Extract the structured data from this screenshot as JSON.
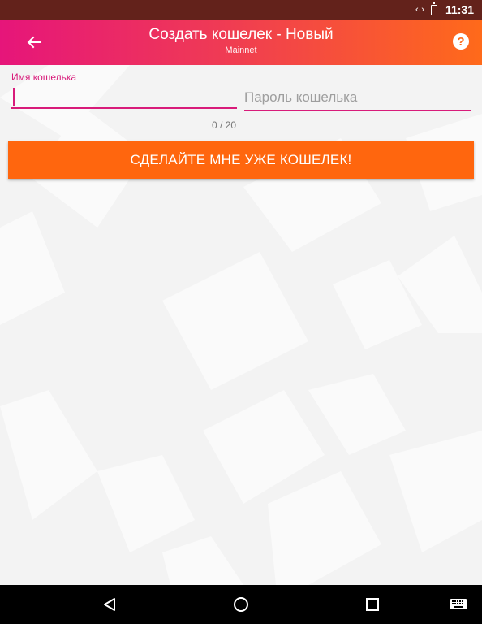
{
  "status_bar": {
    "time": "11:31",
    "icons": [
      "data-sync-icon",
      "battery-icon"
    ]
  },
  "app_bar": {
    "title": "Создать кошелек - Новый",
    "subtitle": "Mainnet",
    "back_icon": "arrow-left-icon",
    "help_icon": "help-icon",
    "help_glyph": "?",
    "colors": {
      "gradient_start": "#e6157a",
      "gradient_end": "#ff6a1a"
    }
  },
  "form": {
    "wallet_name": {
      "label": "Имя кошелька",
      "value": "",
      "counter": "0 / 20"
    },
    "wallet_password": {
      "placeholder": "Пароль кошелька",
      "value": ""
    },
    "submit_label": "СДЕЛАЙТЕ МНЕ УЖЕ КОШЕЛЕК!",
    "accent_color": "#d81b7a",
    "button_color": "#ff660e"
  },
  "nav_bar": {
    "items": [
      "back-triangle-icon",
      "home-circle-icon",
      "recents-square-icon",
      "keyboard-icon"
    ]
  }
}
